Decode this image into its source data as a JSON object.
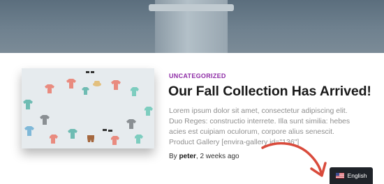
{
  "post": {
    "category": "UNCATEGORIZED",
    "title": "Our Fall Collection Has Arrived!",
    "excerpt": "Lorem ipsum dolor sit amet, consectetur adipiscing elit. Duo Reges: constructio interrete. Illa sunt similia: hebes acies est cuipiam oculorum, corpore alius senescit. Product Gallery [envira-gallery id=\"136\"]",
    "byline_prefix": "By",
    "author": "peter",
    "date": ", 2 weeks ago"
  },
  "language_switcher": {
    "label": "English",
    "flag_icon": "us-flag-icon"
  },
  "colors": {
    "category": "#8e2ca6",
    "annotation_arrow": "#d94b3c",
    "switcher_background": "#1f2329"
  }
}
